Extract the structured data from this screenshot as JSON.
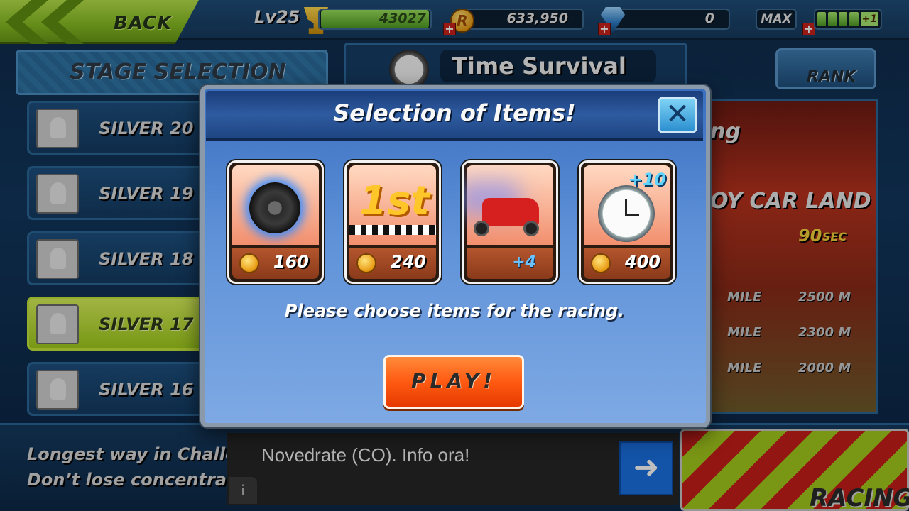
{
  "topbar": {
    "back_label": "BACK",
    "level": "Lv25",
    "xp": "43027",
    "coins": "633,950",
    "gems": "0",
    "max_label": "MAX",
    "fuel_bonus": "+1",
    "plus_symbol": "+"
  },
  "stage_selection": {
    "title": "STAGE SELECTION",
    "items": [
      {
        "label": "SILVER 20"
      },
      {
        "label": "SILVER 19"
      },
      {
        "label": "SILVER 18"
      },
      {
        "label": "SILVER 17",
        "active": true
      },
      {
        "label": "SILVER 16"
      }
    ]
  },
  "mode": {
    "title": "Time Survival",
    "rank_label": "RANK"
  },
  "preview": {
    "title_fragment": "ng",
    "land_name": "OY CAR LAND",
    "time_value": "90",
    "time_unit": "SEC",
    "miles": [
      {
        "label": "MILE",
        "value": "2500 M"
      },
      {
        "label": "MILE",
        "value": "2300 M"
      },
      {
        "label": "MILE",
        "value": "2000 M"
      }
    ]
  },
  "footer": {
    "hint_line1": "Longest way in Challe",
    "hint_line2": "Don’t lose concentrati",
    "racing_label": "RACING"
  },
  "ad": {
    "text": "Novedrate (CO). Info ora!",
    "arrow": "➜",
    "info": "i"
  },
  "modal": {
    "title": "Selection of Items!",
    "close_glyph": "✕",
    "items": [
      {
        "name": "nitro-tire",
        "price": "160"
      },
      {
        "name": "first-start",
        "art_text": "1st",
        "price": "240"
      },
      {
        "name": "extra-cars",
        "bonus": "+4"
      },
      {
        "name": "extra-time",
        "art_text": "+10",
        "price": "400"
      }
    ],
    "message": "Please choose items for the racing.",
    "play_label": "PLAY!"
  },
  "colors": {
    "accent_green": "#9fcb1c",
    "play_orange": "#ff5a12",
    "modal_blue": "#5f92d8"
  }
}
